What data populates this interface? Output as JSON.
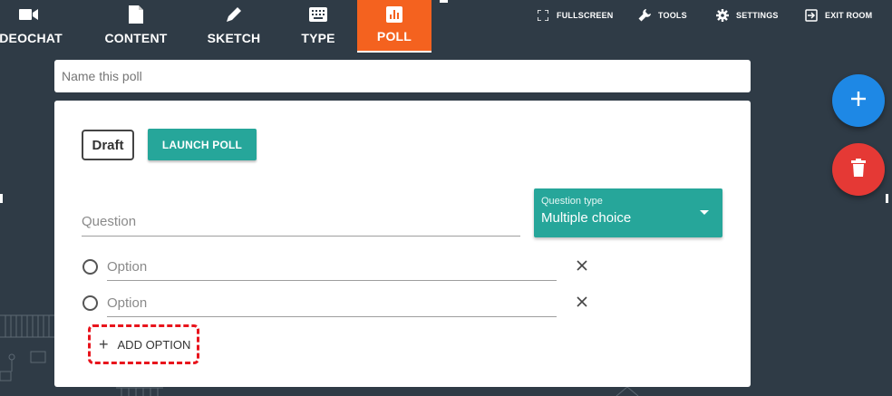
{
  "nav": {
    "tabs": [
      {
        "label": "IDEOCHAT",
        "icon": "video-camera-icon"
      },
      {
        "label": "CONTENT",
        "icon": "document-icon"
      },
      {
        "label": "SKETCH",
        "icon": "pencil-icon"
      },
      {
        "label": "TYPE",
        "icon": "keyboard-icon"
      },
      {
        "label": "POLL",
        "icon": "poll-chart-icon"
      }
    ],
    "active_tab": "POLL",
    "active_color": "#f4621f",
    "tools": [
      {
        "label": "FULLSCREEN",
        "icon": "fullscreen-icon"
      },
      {
        "label": "TOOLS",
        "icon": "wrench-icon"
      },
      {
        "label": "SETTINGS",
        "icon": "gear-icon"
      },
      {
        "label": "EXIT ROOM",
        "icon": "exit-icon"
      }
    ]
  },
  "poll": {
    "name_placeholder": "Name this poll",
    "status": "Draft",
    "launch_label": "LAUNCH POLL",
    "question_placeholder": "Question",
    "question_type": {
      "label": "Question type",
      "value": "Multiple choice"
    },
    "options": [
      {
        "placeholder": "Option"
      },
      {
        "placeholder": "Option"
      }
    ],
    "add_option_label": "ADD OPTION"
  },
  "fabs": {
    "add": {
      "icon": "plus-icon",
      "color": "#1e88e5"
    },
    "delete": {
      "icon": "trash-icon",
      "color": "#e53935"
    }
  },
  "colors": {
    "background": "#2f3b46",
    "teal": "#26a69a",
    "highlight": "#e8141c"
  }
}
